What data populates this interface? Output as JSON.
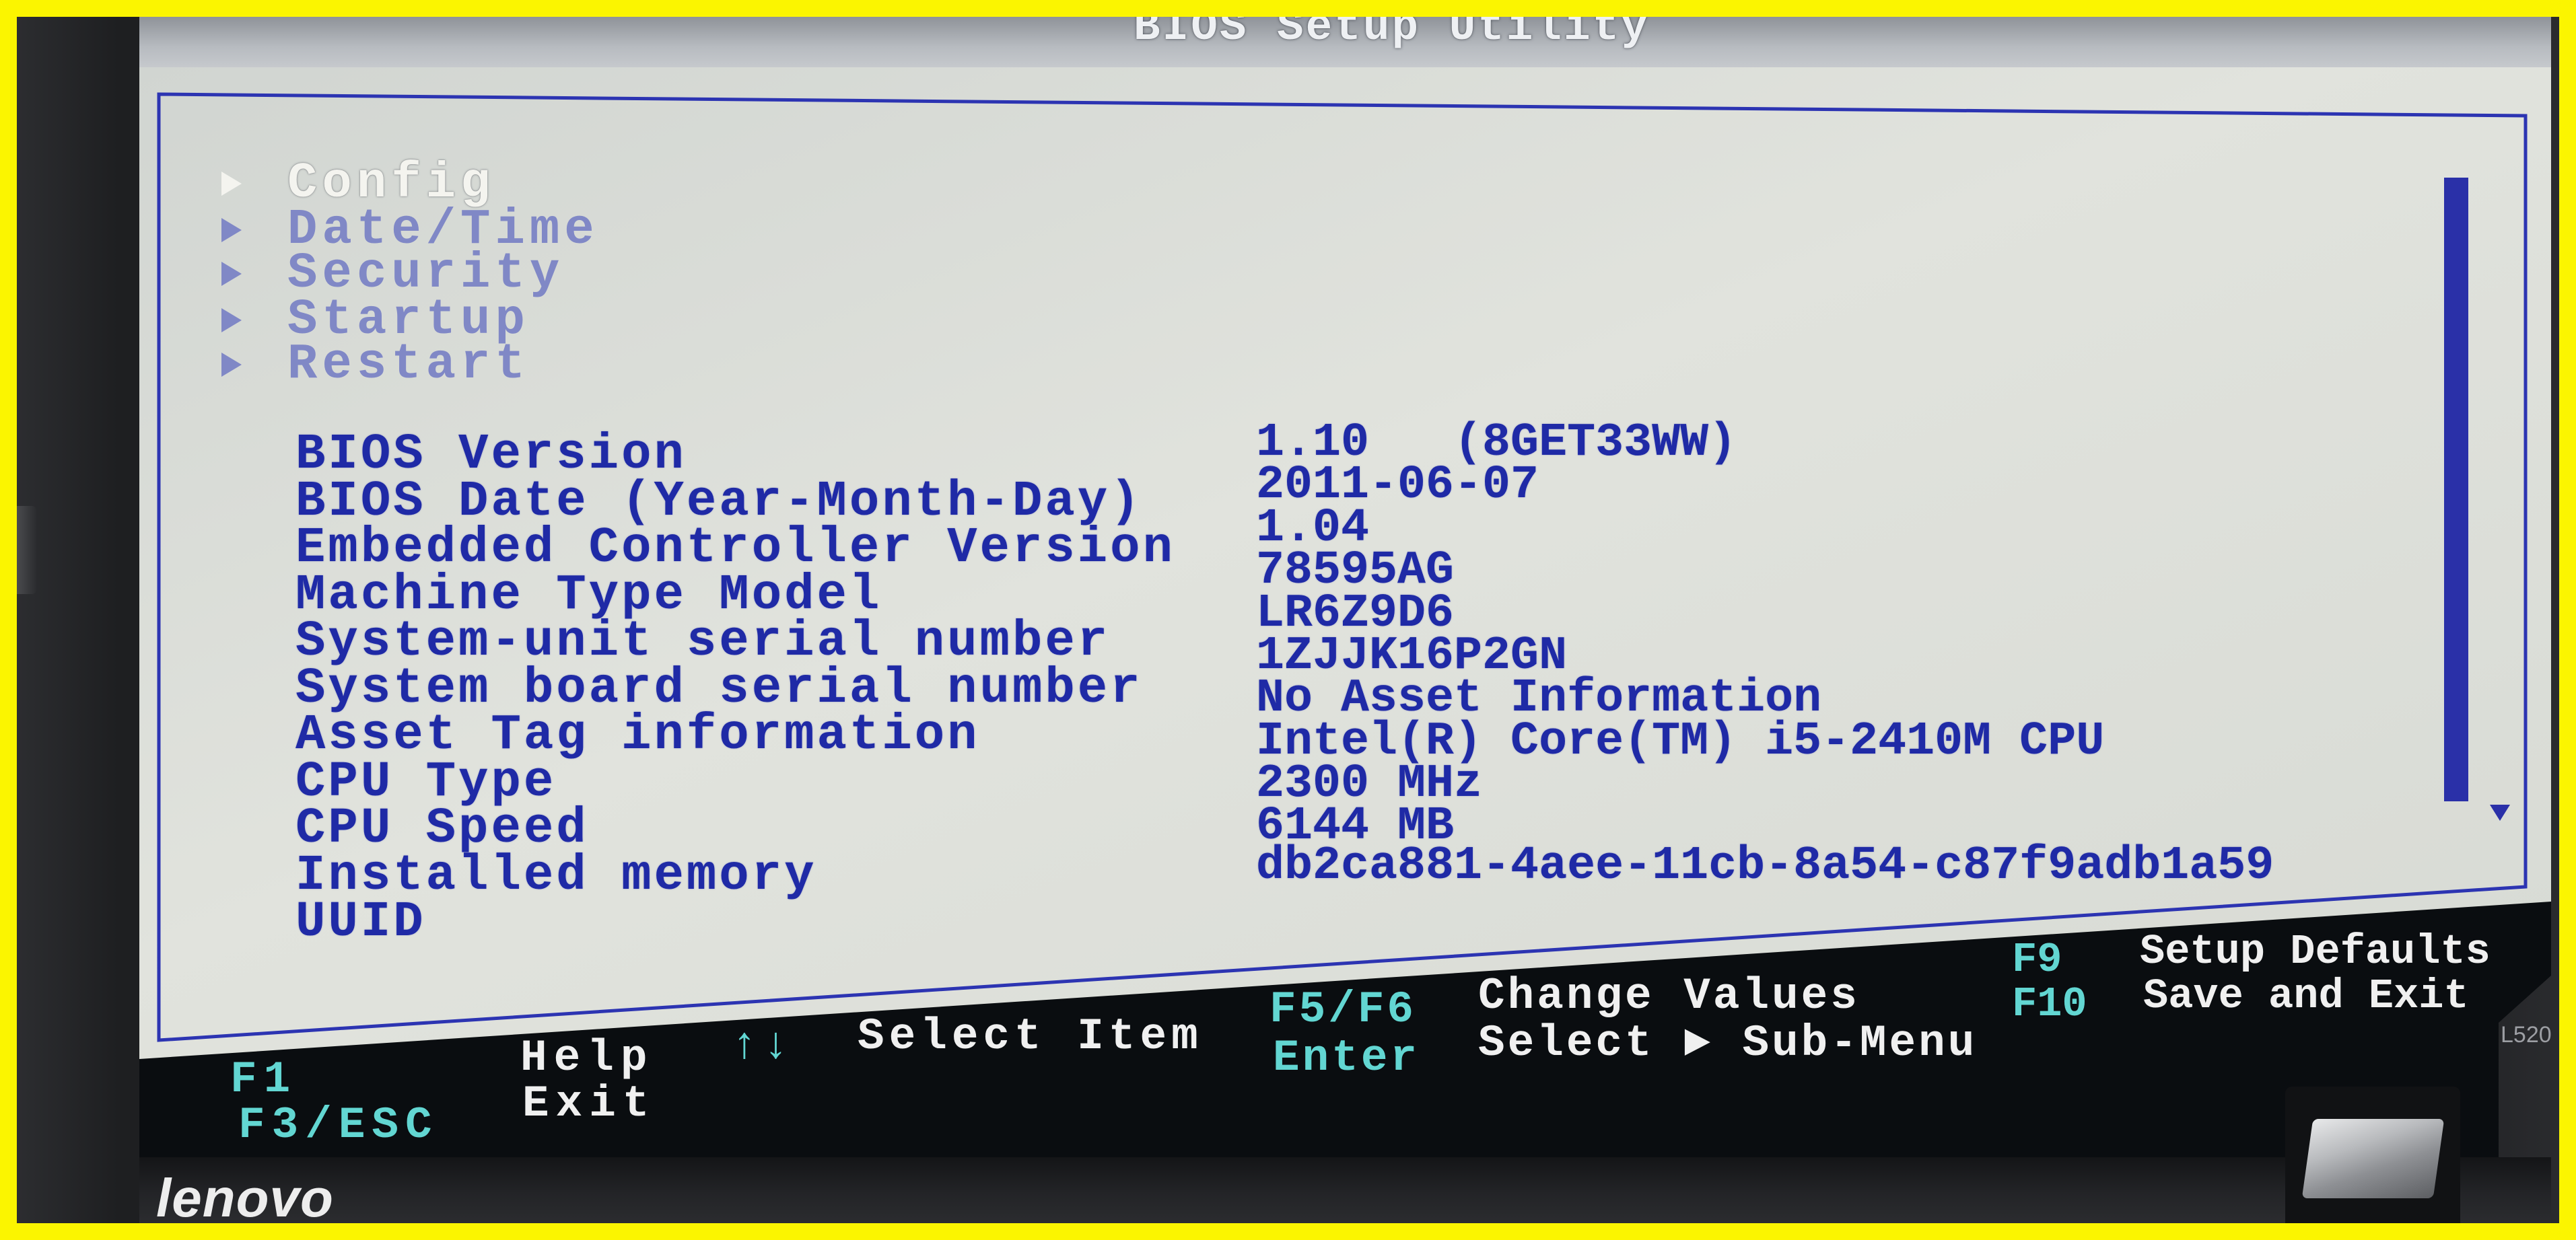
{
  "window": {
    "title": "BIOS Setup Utility"
  },
  "menu": {
    "items": [
      {
        "label": "Config",
        "selected": true
      },
      {
        "label": "Date/Time",
        "selected": false
      },
      {
        "label": "Security",
        "selected": false
      },
      {
        "label": "Startup",
        "selected": false
      },
      {
        "label": "Restart",
        "selected": false
      }
    ]
  },
  "system_info": {
    "rows": [
      {
        "label": "BIOS Version",
        "value": "1.10   (8GET33WW)"
      },
      {
        "label": "BIOS Date (Year-Month-Day)",
        "value": "2011-06-07"
      },
      {
        "label": "Embedded Controller Version",
        "value": "1.04"
      },
      {
        "label": "Machine Type Model",
        "value": "78595AG"
      },
      {
        "label": "System-unit serial number",
        "value": "LR6Z9D6"
      },
      {
        "label": "System board serial number",
        "value": "1ZJJK16P2GN"
      },
      {
        "label": "Asset Tag information",
        "value": "No Asset Information"
      },
      {
        "label": "CPU Type",
        "value": "Intel(R) Core(TM) i5-2410M CPU"
      },
      {
        "label": "CPU Speed",
        "value": "2300 MHz"
      },
      {
        "label": "Installed memory",
        "value": "6144 MB"
      },
      {
        "label": "UUID",
        "value": "db2ca881-4aee-11cb-8a54-c87f9adb1a59"
      }
    ]
  },
  "help_bar": {
    "items": [
      {
        "key": "F1",
        "action": "Help"
      },
      {
        "key": "F3/ESC",
        "action": "Exit"
      },
      {
        "key": "↑↓",
        "action": "Select Item"
      },
      {
        "key": "F5/F6",
        "action": "Change Values"
      },
      {
        "key": "Enter",
        "action": "Select ► Sub-Menu"
      },
      {
        "key": "F9",
        "action": "Setup Defaults"
      },
      {
        "key": "F10",
        "action": "Save and Exit"
      }
    ]
  },
  "laptop": {
    "brand_logo": "lenovo",
    "model_label": "L520"
  },
  "icons": {
    "menu_item": "triangle-right-icon",
    "scroll_down": "triangle-down-icon"
  },
  "colors": {
    "border_frame": "#fbf500",
    "screen_background": "#0a0d10",
    "text_blue": "#1f2aa6",
    "menu_selected": "#f4f4ef",
    "menu_inactive": "#8088c6",
    "help_key": "#62d6d2",
    "help_action": "#f0f0f0",
    "scrollbar": "#2a30a8",
    "panel_border": "#2c34b2"
  }
}
